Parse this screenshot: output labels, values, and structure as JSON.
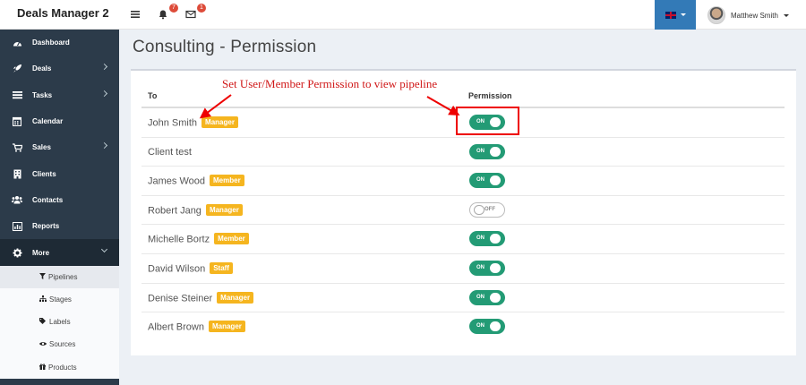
{
  "app": {
    "title": "Deals Manager 2"
  },
  "topbar": {
    "notifications_count": "7",
    "messages_count": "1",
    "user_name": "Matthew Smith",
    "icons": [
      "hamburger-icon",
      "bell-icon",
      "envelope-icon",
      "uk-flag-icon"
    ]
  },
  "colors": {
    "sidebar": "#2c3b4a",
    "lang_button": "#337ab7",
    "toggle_on": "#239b75",
    "role_badge": "#f5b51f",
    "annotation": "#d01818"
  },
  "sidebar": {
    "items": [
      {
        "label": "Dashboard",
        "icon": "dashboard-icon"
      },
      {
        "label": "Deals",
        "icon": "rocket-icon"
      },
      {
        "label": "Tasks",
        "icon": "tasks-icon"
      },
      {
        "label": "Calendar",
        "icon": "calendar-icon"
      },
      {
        "label": "Sales",
        "icon": "cart-icon"
      },
      {
        "label": "Clients",
        "icon": "building-icon"
      },
      {
        "label": "Contacts",
        "icon": "users-icon"
      },
      {
        "label": "Reports",
        "icon": "chart-icon"
      },
      {
        "label": "More",
        "icon": "cog-icon"
      }
    ],
    "subitems": [
      {
        "label": "Pipelines",
        "icon": "filter-icon"
      },
      {
        "label": "Stages",
        "icon": "sitemap-icon"
      },
      {
        "label": "Labels",
        "icon": "tags-icon"
      },
      {
        "label": "Sources",
        "icon": "eye-icon"
      },
      {
        "label": "Products",
        "icon": "gift-icon"
      }
    ]
  },
  "page": {
    "title": "Consulting - Permission"
  },
  "table": {
    "col_to": "To",
    "col_permission": "Permission",
    "rows": [
      {
        "name": "John Smith",
        "role": "Manager",
        "permission": "ON"
      },
      {
        "name": "Client test",
        "role": "",
        "permission": "ON"
      },
      {
        "name": "James Wood",
        "role": "Member",
        "permission": "ON"
      },
      {
        "name": "Robert Jang",
        "role": "Manager",
        "permission": "OFF"
      },
      {
        "name": "Michelle Bortz",
        "role": "Member",
        "permission": "ON"
      },
      {
        "name": "David Wilson",
        "role": "Staff",
        "permission": "ON"
      },
      {
        "name": "Denise Steiner",
        "role": "Manager",
        "permission": "ON"
      },
      {
        "name": "Albert Brown",
        "role": "Manager",
        "permission": "ON"
      }
    ]
  },
  "annotation": {
    "text": "Set User/Member Permission to view pipeline"
  }
}
